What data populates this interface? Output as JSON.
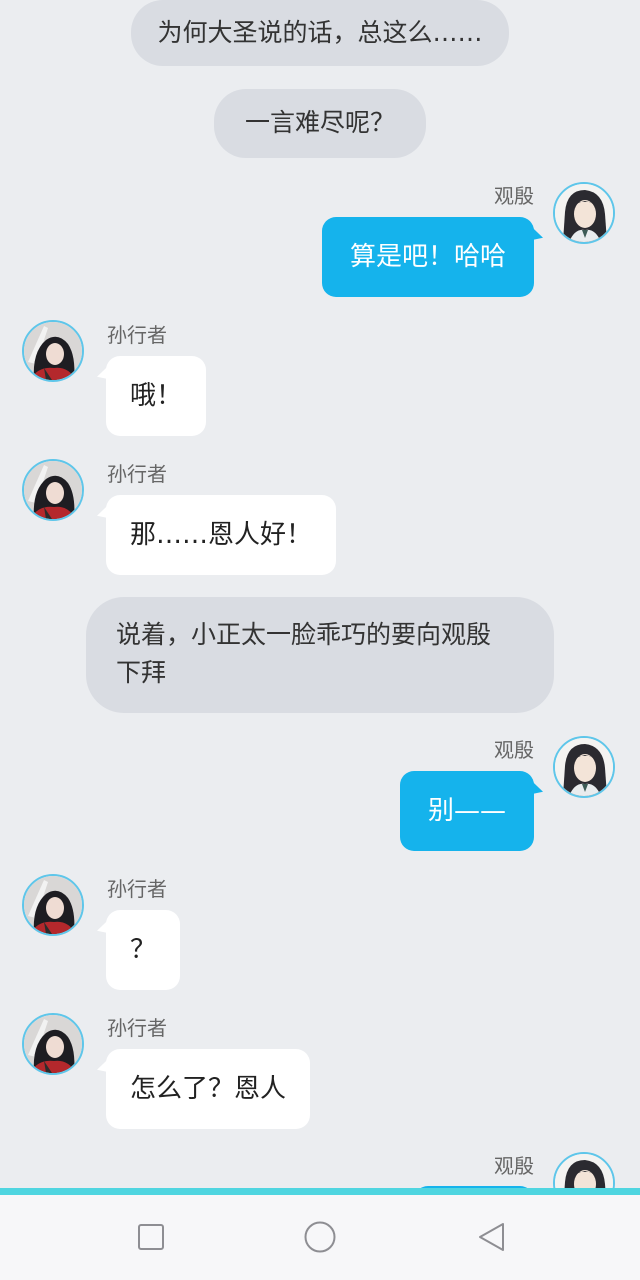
{
  "messages": [
    {
      "type": "narration",
      "text": "为何大圣说的话，总这么……"
    },
    {
      "type": "narration",
      "text": "一言难尽呢？"
    },
    {
      "type": "outgoing",
      "sender": "观殷",
      "text": "算是吧！哈哈"
    },
    {
      "type": "incoming",
      "sender": "孙行者",
      "text": "哦！"
    },
    {
      "type": "incoming",
      "sender": "孙行者",
      "text": "那……恩人好！"
    },
    {
      "type": "narration",
      "text": "说着，小正太一脸乖巧的要向观殷下拜"
    },
    {
      "type": "outgoing",
      "sender": "观殷",
      "text": "别——"
    },
    {
      "type": "incoming",
      "sender": "孙行者",
      "text": "？"
    },
    {
      "type": "incoming",
      "sender": "孙行者",
      "text": "怎么了？恩人"
    },
    {
      "type": "outgoing",
      "sender": "观殷",
      "text": ""
    }
  ],
  "narration_multiline": {
    "line1": "说着，小正太一脸乖巧的要向观殷",
    "line2": "下拜"
  },
  "colors": {
    "background": "#ebedf0",
    "narration_bubble": "#d9dce2",
    "outgoing_bubble": "#15b3ec",
    "incoming_bubble": "#ffffff",
    "avatar_ring": "#5ec6ea",
    "accent_bar": "#4fd5e0"
  },
  "navbar": {
    "icons": [
      "square-recents-icon",
      "circle-home-icon",
      "triangle-back-icon"
    ]
  }
}
